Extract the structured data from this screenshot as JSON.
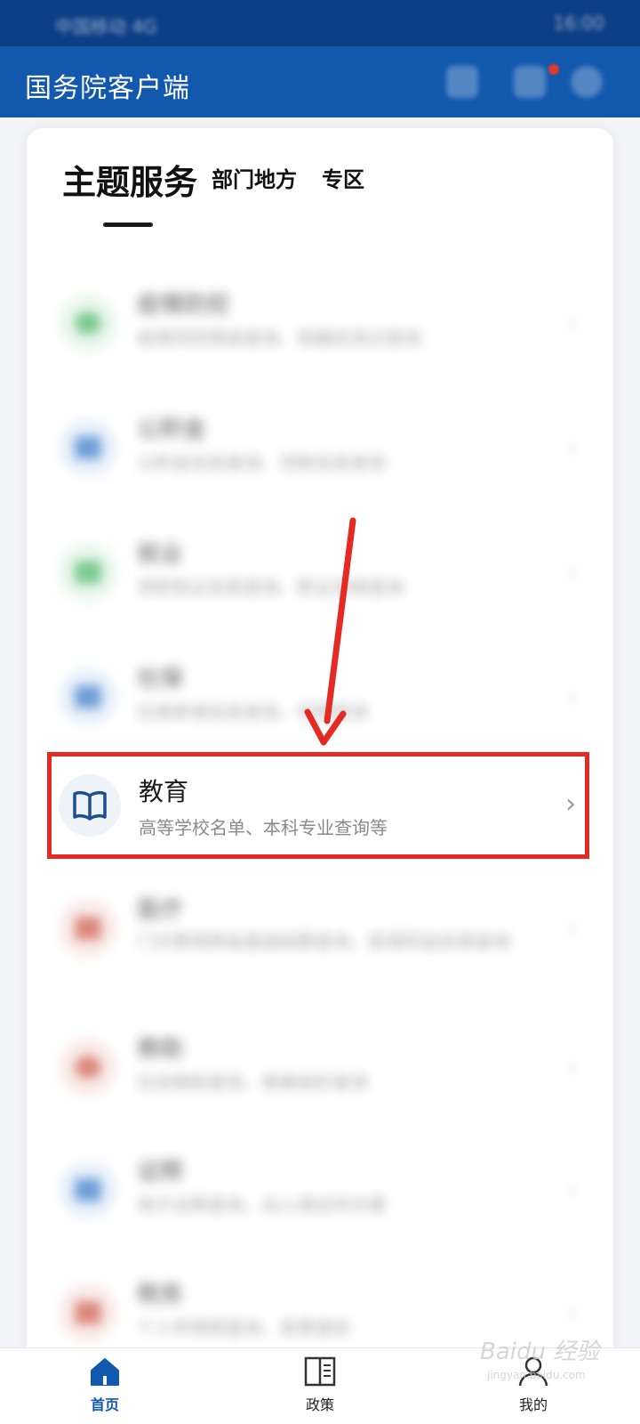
{
  "status_bar": {
    "left_text": "中国移动 4G",
    "right_text": "16:00"
  },
  "app_bar": {
    "title": "国务院客户端"
  },
  "tabs": [
    {
      "label": "主题服务",
      "active": true
    },
    {
      "label": "部门地方",
      "active": false
    },
    {
      "label": "专区",
      "active": false
    }
  ],
  "services": [
    {
      "title": "疫情防控",
      "desc": "疫情风险等级查询、核酸检测点查询",
      "icon": "shield-icon",
      "color": "#4fb86a",
      "blurred": true
    },
    {
      "title": "公积金",
      "desc": "公积金信息查询、贷款信息查询",
      "icon": "lock-icon",
      "color": "#3b7ec9",
      "blurred": true
    },
    {
      "title": "就业",
      "desc": "求职就业信息查询、职业资格查询",
      "icon": "briefcase-icon",
      "color": "#4fb86a",
      "blurred": true
    },
    {
      "title": "社保",
      "desc": "社保参保信息查询、待遇查询",
      "icon": "card-icon",
      "color": "#3b7ec9",
      "blurred": true
    },
    {
      "title": "教育",
      "desc": "高等学校名单、本科专业查询等",
      "icon": "book-icon",
      "color": "#1e4f8f",
      "blurred": false,
      "highlighted": true
    },
    {
      "title": "医疗",
      "desc": "门诊费用跨省直接结算查询、医保药品目录查询",
      "icon": "medical-icon",
      "color": "#d0604f",
      "blurred": true
    },
    {
      "title": "救助",
      "desc": "社会救助查询、慈善组织查询",
      "icon": "heart-icon",
      "color": "#d0604f",
      "blurred": true
    },
    {
      "title": "证照",
      "desc": "电子证照查询、出入境证件办理",
      "icon": "document-icon",
      "color": "#3b7ec9",
      "blurred": true
    },
    {
      "title": "税务",
      "desc": "个人所得税查询、发票查验",
      "icon": "tax-icon",
      "color": "#d0604f",
      "blurred": true
    }
  ],
  "bottom_nav": [
    {
      "label": "首页",
      "icon": "home-icon",
      "active": true
    },
    {
      "label": "政策",
      "icon": "book-open-icon",
      "active": false
    },
    {
      "label": "我的",
      "icon": "user-icon",
      "active": false
    }
  ],
  "watermark": {
    "text": "Baidu 经验",
    "sub": "jingyan.baidu.com"
  },
  "colors": {
    "header": "#1258ad",
    "status": "#0d3f86",
    "highlight": "#e52a24",
    "arrow": "#e52a24"
  }
}
